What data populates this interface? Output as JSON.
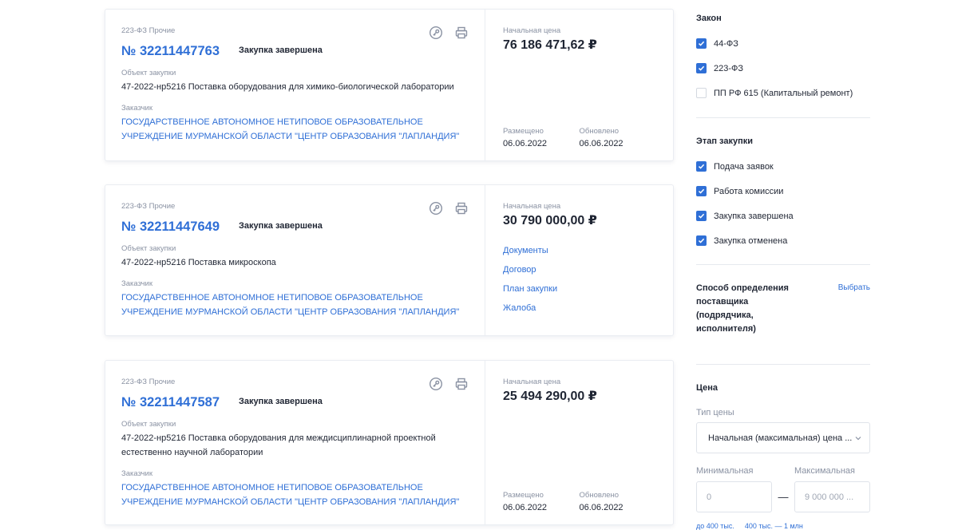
{
  "cards": [
    {
      "law": "223-ФЗ Прочие",
      "number": "№ 32211447763",
      "status": "Закупка завершена",
      "object_label": "Объект закупки",
      "object": "47-2022-нр5216 Поставка оборудования для химико-биологической лаборатории",
      "customer_label": "Заказчик",
      "customer": "ГОСУДАРСТВЕННОЕ АВТОНОМНОЕ НЕТИПОВОЕ ОБРАЗОВАТЕЛЬНОЕ УЧРЕЖДЕНИЕ МУРМАНСКОЙ ОБЛАСТИ \"ЦЕНТР ОБРАЗОВАНИЯ \"ЛАПЛАНДИЯ\"",
      "price_label": "Начальная цена",
      "price": "76 186 471,62 ₽",
      "posted_label": "Размещено",
      "posted": "06.06.2022",
      "updated_label": "Обновлено",
      "updated": "06.06.2022"
    },
    {
      "law": "223-ФЗ Прочие",
      "number": "№ 32211447649",
      "status": "Закупка завершена",
      "object_label": "Объект закупки",
      "object": "47-2022-нр5216 Поставка микроскопа",
      "customer_label": "Заказчик",
      "customer": "ГОСУДАРСТВЕННОЕ АВТОНОМНОЕ НЕТИПОВОЕ ОБРАЗОВАТЕЛЬНОЕ УЧРЕЖДЕНИЕ МУРМАНСКОЙ ОБЛАСТИ \"ЦЕНТР ОБРАЗОВАНИЯ \"ЛАПЛАНДИЯ\"",
      "price_label": "Начальная цена",
      "price": "30 790 000,00 ₽",
      "links": [
        "Документы",
        "Договор",
        "План закупки",
        "Жалоба"
      ]
    },
    {
      "law": "223-ФЗ Прочие",
      "number": "№ 32211447587",
      "status": "Закупка завершена",
      "object_label": "Объект закупки",
      "object": "47-2022-нр5216 Поставка оборудования для междисциплинарной проектной естественно научной лаборатории",
      "customer_label": "Заказчик",
      "customer": "ГОСУДАРСТВЕННОЕ АВТОНОМНОЕ НЕТИПОВОЕ ОБРАЗОВАТЕЛЬНОЕ УЧРЕЖДЕНИЕ МУРМАНСКОЙ ОБЛАСТИ \"ЦЕНТР ОБРАЗОВАНИЯ \"ЛАПЛАНДИЯ\"",
      "price_label": "Начальная цена",
      "price": "25 494 290,00 ₽",
      "posted_label": "Размещено",
      "posted": "06.06.2022",
      "updated_label": "Обновлено",
      "updated": "06.06.2022"
    }
  ],
  "filters": {
    "law": {
      "title": "Закон",
      "options": [
        {
          "label": "44-ФЗ",
          "checked": true
        },
        {
          "label": "223-ФЗ",
          "checked": true
        },
        {
          "label": "ПП РФ 615 (Капитальный ремонт)",
          "checked": false
        }
      ]
    },
    "stage": {
      "title": "Этап закупки",
      "options": [
        {
          "label": "Подача заявок",
          "checked": true
        },
        {
          "label": "Работа комиссии",
          "checked": true
        },
        {
          "label": "Закупка завершена",
          "checked": true
        },
        {
          "label": "Закупка отменена",
          "checked": true
        }
      ]
    },
    "method": {
      "title": "Способ определения поставщика (подрядчика, исполнителя)",
      "action": "Выбрать"
    },
    "price": {
      "title": "Цена",
      "type_label": "Тип цены",
      "type_value": "Начальная (максимальная) цена ...",
      "min_label": "Минимальная",
      "max_label": "Максимальная",
      "min_placeholder": "0",
      "max_placeholder": "9 000 000 ...",
      "quick": [
        "до 400 тыс.",
        "400 тыс. — 1 млн"
      ]
    }
  },
  "colors": {
    "accent": "#2f6fd6",
    "text": "#1f2533",
    "muted": "#8a92a3"
  }
}
